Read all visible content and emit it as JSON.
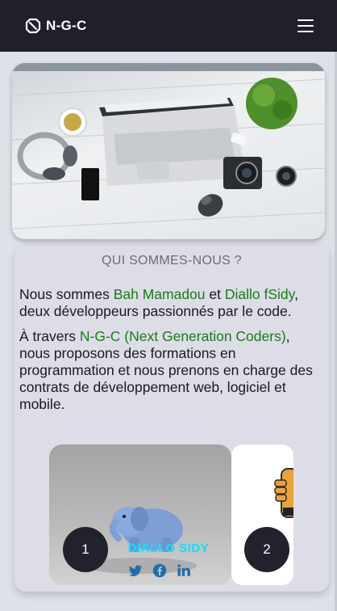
{
  "navbar": {
    "brand": "N-G-C",
    "brand_icon": "logo-icon",
    "menu_icon": "hamburger-icon"
  },
  "hero": {
    "image": "desk-workspace-photo"
  },
  "about": {
    "title": "QUI SOMMES-NOUS ?",
    "p1_before": "Nous sommes ",
    "p1_name1": "Bah Mamadou",
    "p1_mid": " et ",
    "p1_name2": "Diallo fSidy",
    "p1_after": ", deux développeurs passionnés par le code.",
    "p2_before": "À travers ",
    "p2_org": "N-G-C (Next Generation Coders)",
    "p2_after": ", nous proposons des formations en programmation et nous prenons en charge des contrats de développement web, logiciel et mobile."
  },
  "team": {
    "cards": [
      {
        "number": "1",
        "name": "DIALLO SIDY",
        "image": "elephant-mascot",
        "socials": [
          "twitter-icon",
          "facebook-icon",
          "linkedin-icon"
        ]
      },
      {
        "number": "2",
        "image": "thumbs-up-cartoon"
      }
    ]
  },
  "colors": {
    "navbar_bg": "#1f2029",
    "page_bg": "#dfe1e9",
    "highlight": "#1a7a1a",
    "name_cyan": "#00e5ff",
    "social_blue": "#1d6fb0"
  }
}
